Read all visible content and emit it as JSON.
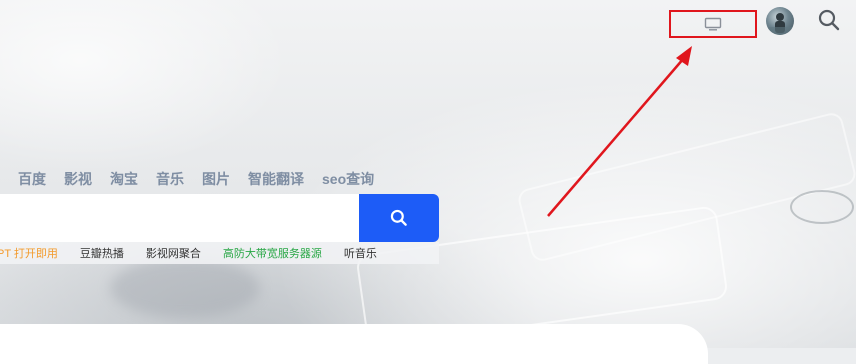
{
  "header": {
    "screen_button_icon": "monitor-icon",
    "avatar_icon": "user-avatar",
    "search_icon": "search-icon"
  },
  "tabs": [
    "百度",
    "影视",
    "淘宝",
    "音乐",
    "图片",
    "智能翻译",
    "seo查询"
  ],
  "search": {
    "value": "",
    "placeholder": "",
    "button_icon": "search-icon",
    "accent_color": "#1d5cf7"
  },
  "hotwords": [
    {
      "label": "PT 打开即用",
      "color": "#f39a2b"
    },
    {
      "label": "豆瓣热播",
      "color": "#333333"
    },
    {
      "label": "影视网聚合",
      "color": "#333333"
    },
    {
      "label": "高防大带宽服务器源",
      "color": "#28a745"
    },
    {
      "label": "听音乐",
      "color": "#333333"
    }
  ],
  "annotation": {
    "highlight_color": "#e0161d"
  }
}
